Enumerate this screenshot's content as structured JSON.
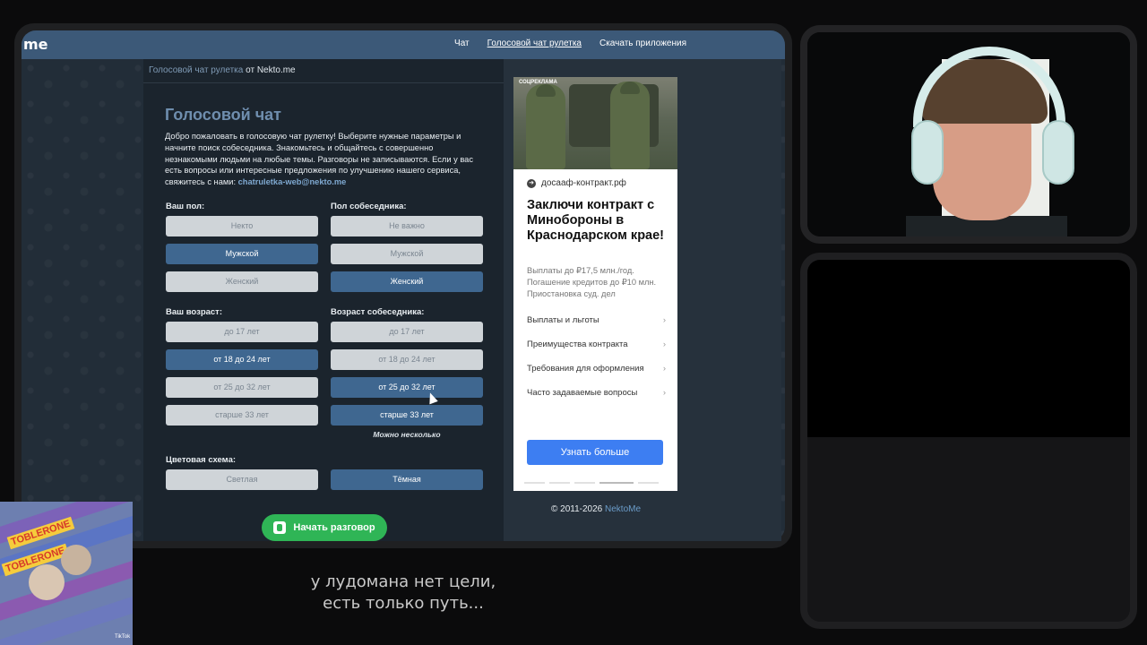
{
  "site": {
    "logo": "me",
    "nav": [
      "Чат",
      "Голосовой чат рулетка",
      "Скачать приложения"
    ]
  },
  "breadcrumb": {
    "link": "Голосовой чат рулетка",
    "rest": "от Nekto.me"
  },
  "page_title": "Голосовой чат",
  "intro": {
    "text": "Добро пожаловать в голосовую чат рулетку! Выберите нужные параметры и начните поиск собеседника. Знакомьтесь и общайтесь с совершенно незнакомыми людьми на любые темы. Разговоры не записываются. Если у вас есть вопросы или интересные предложения по улучшению нашего сервиса, свяжитесь с нами:",
    "email": "chatruletka-web@nekto.me"
  },
  "form": {
    "your_gender": {
      "label": "Ваш пол:",
      "options": [
        "Некто",
        "Мужской",
        "Женский"
      ],
      "selected": "Мужской"
    },
    "partner_gender": {
      "label": "Пол собеседника:",
      "options": [
        "Не важно",
        "Мужской",
        "Женский"
      ],
      "selected": "Женский"
    },
    "your_age": {
      "label": "Ваш возраст:",
      "options": [
        "до 17 лет",
        "от 18 до 24 лет",
        "от 25 до 32 лет",
        "старше 33 лет"
      ],
      "selected": "от 18 до 24 лет"
    },
    "partner_age": {
      "label": "Возраст собеседника:",
      "options": [
        "до 17 лет",
        "от 18 до 24 лет",
        "от 25 до 32 лет",
        "старше 33 лет"
      ],
      "selected": [
        "от 25 до 32 лет",
        "старше 33 лет"
      ],
      "hint": "Можно несколько"
    },
    "color_scheme": {
      "label": "Цветовая схема:",
      "options": [
        "Светлая",
        "Тёмная"
      ],
      "selected": "Тёмная"
    },
    "start_button": "Начать разговор"
  },
  "ad": {
    "watermark": "СОЦРЕКЛАМА",
    "source": "досааф-контракт.рф",
    "title": "Заключи контракт с Минобороны в Краснодарском крае!",
    "description": "Выплаты до ₽17,5 млн./год. Погашение кредитов до ₽10 млн. Приостановка суд. дел",
    "links": [
      "Выплаты и льготы",
      "Преимущества контракта",
      "Требования для оформления",
      "Часто задаваемые вопросы"
    ],
    "cta": "Узнать больше"
  },
  "footer": {
    "copyright": "© 2011-2026",
    "name": "NektoMe"
  },
  "subtitles": [
    "у лудомана нет цели,",
    "есть только путь..."
  ],
  "overlay": {
    "brand": "TOBLERONE",
    "tiktok": "TikTok"
  },
  "colors": {
    "topbar": "#3c5978",
    "selected_button": "#3f6790",
    "unselected_button": "#cfd4d8",
    "start_button": "#2fb556",
    "ad_cta": "#3d7ef2"
  }
}
